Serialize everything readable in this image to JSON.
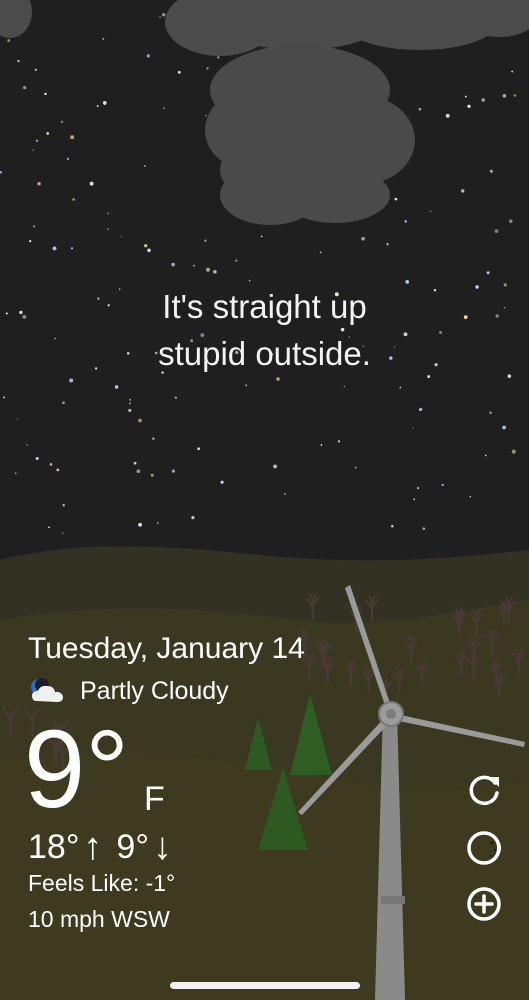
{
  "quip": {
    "line1": "It's straight up",
    "line2": "stupid outside."
  },
  "weather": {
    "date": "Tuesday, January 14",
    "condition_icon": "partly-cloudy-night-icon",
    "condition": "Partly Cloudy",
    "temperature": "9°",
    "unit": "F",
    "high": "18°",
    "high_arrow": "↑",
    "low": "9°",
    "low_arrow": "↓",
    "feels_like": "Feels Like: -1°",
    "wind": "10 mph WSW"
  },
  "actions": {
    "refresh_icon": "refresh-icon",
    "theme_icon": "moon-phase-icon",
    "add_icon": "add-location-icon"
  },
  "colors": {
    "sky": "#1f1f1f",
    "hills": "#3a3722",
    "cloud": "#4a4a4a",
    "text": "#ffffff",
    "tree_green": "#2e4a1f",
    "turbine": "#8c8c8c"
  }
}
